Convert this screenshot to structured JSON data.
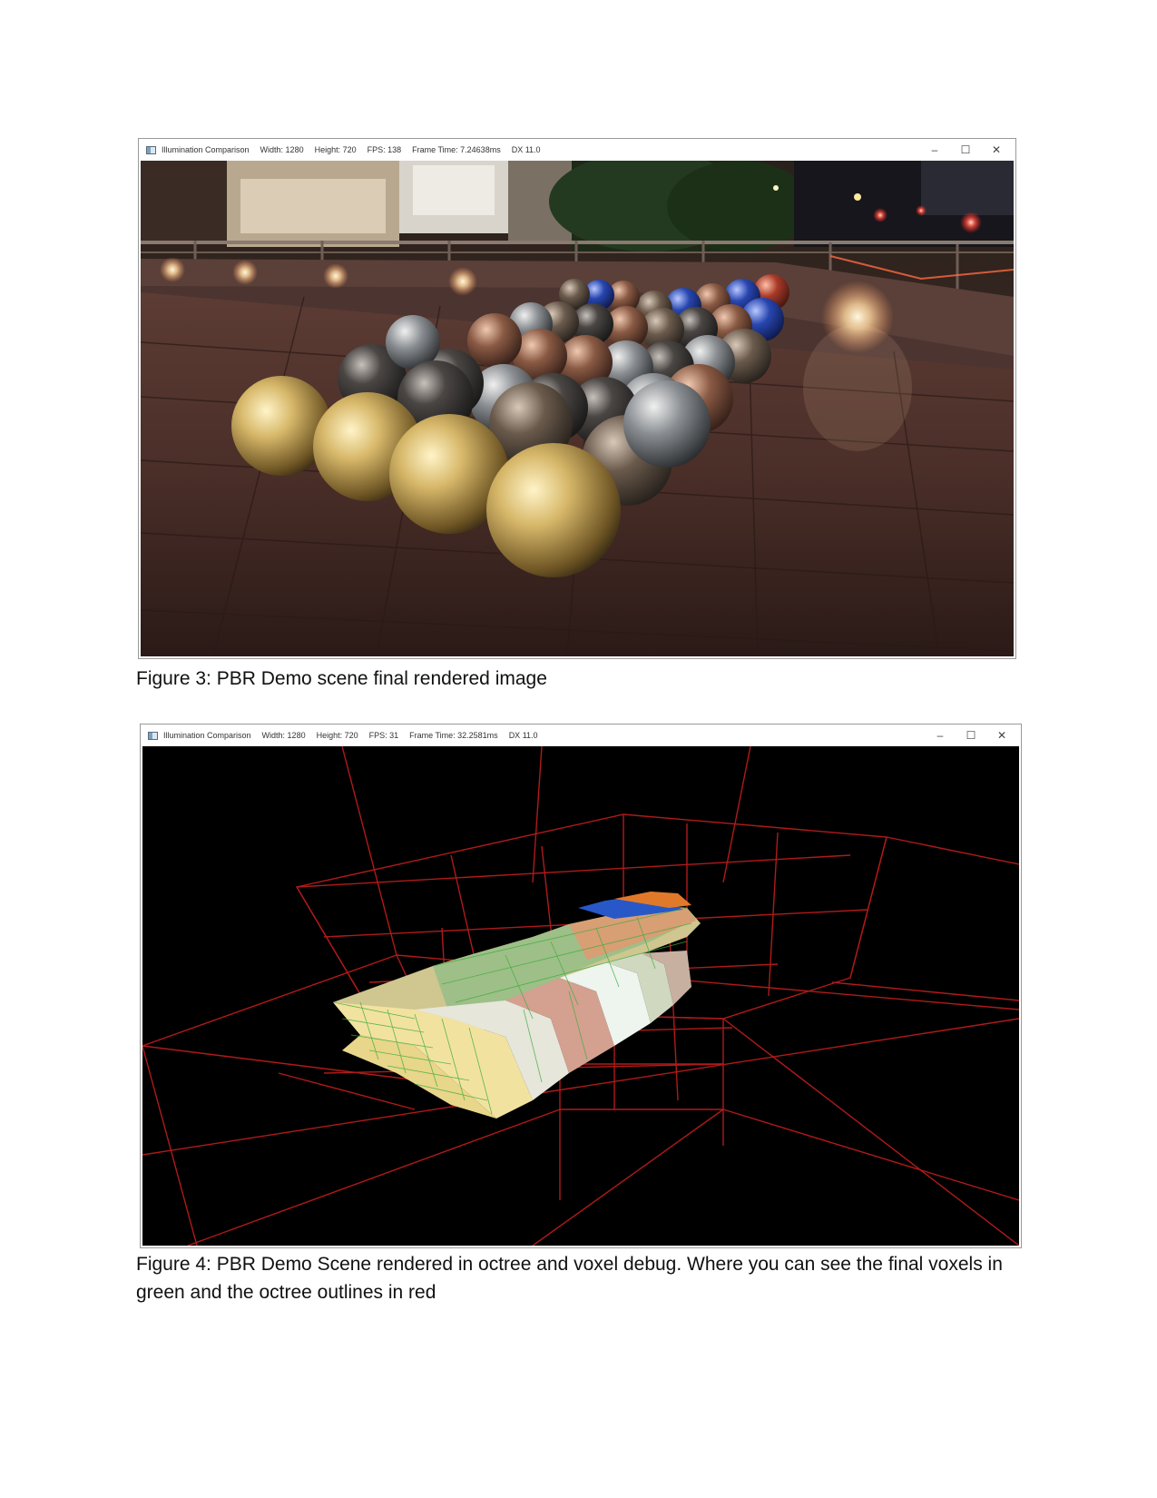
{
  "figures": [
    {
      "window": {
        "title": "Illumination Comparison",
        "width": "Width: 1280",
        "height": "Height: 720",
        "fps": "FPS: 138",
        "frame_time": "Frame Time: 7.24638ms",
        "dx": "DX 11.0",
        "controls": {
          "minimize": "–",
          "maximize": "☐",
          "close": "✕"
        }
      },
      "caption": "Figure 3: PBR Demo scene final rendered image"
    },
    {
      "window": {
        "title": "Illumination Comparison",
        "width": "Width: 1280",
        "height": "Height: 720",
        "fps": "FPS: 31",
        "frame_time": "Frame Time: 32.2581ms",
        "dx": "DX 11.0",
        "controls": {
          "minimize": "–",
          "maximize": "☐",
          "close": "✕"
        }
      },
      "caption": "Figure 4: PBR Demo Scene rendered in octree and voxel debug. Where you can see the final voxels in green and the octree outlines in red"
    }
  ],
  "colors": {
    "octree_outline": "#b01a1a",
    "voxel_outline": "#3fae3f",
    "night_sky": "#1b1412"
  }
}
